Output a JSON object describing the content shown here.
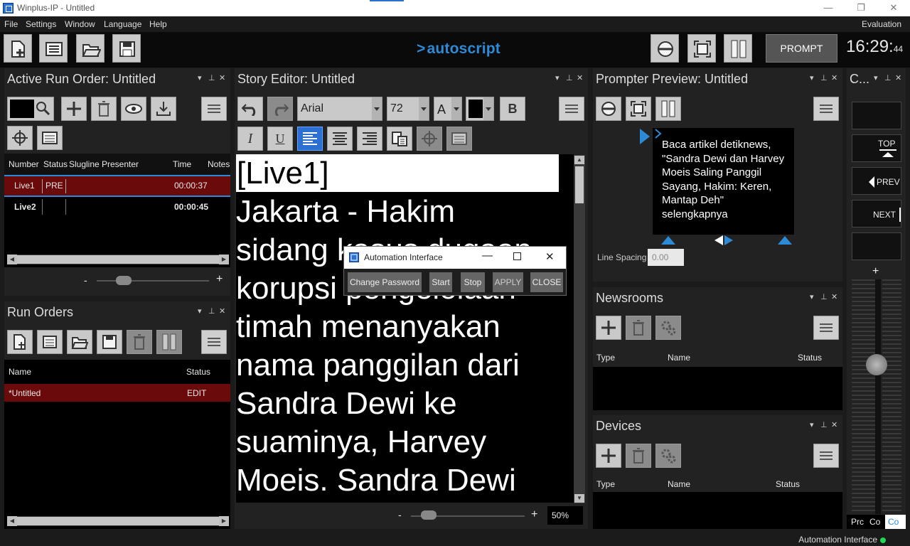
{
  "window": {
    "title": "Winplus-IP - Untitled",
    "controls": {
      "minimize": "—",
      "restore": "❐",
      "close": "✕"
    }
  },
  "menubar": {
    "items": [
      "File",
      "Settings",
      "Window",
      "Language",
      "Help"
    ],
    "license": "Evaluation"
  },
  "toolbar": {
    "brand": "autoscript",
    "prompt_label": "PROMPT",
    "clock_main": "16:29:",
    "clock_seconds": "44"
  },
  "active_run_order": {
    "title": "Active Run Order: Untitled",
    "columns": [
      "Number",
      "Status",
      "Slugline",
      "Presenter",
      "Time",
      "Notes"
    ],
    "rows": [
      {
        "number": "Live1",
        "status": "PRE",
        "time": "00:00:37"
      },
      {
        "number": "Live2",
        "status": "",
        "time": "00:00:45"
      }
    ],
    "zoom_minus": "-",
    "zoom_plus": "+"
  },
  "run_orders": {
    "title": "Run Orders",
    "columns": [
      "Name",
      "Status"
    ],
    "rows": [
      {
        "name": "*Untitled",
        "status": "EDIT"
      }
    ]
  },
  "story_editor": {
    "title": "Story Editor: Untitled",
    "font": "Arial",
    "size": "72",
    "text_color_label": "A",
    "bold": "B",
    "italic": "I",
    "underline": "U",
    "slug": "[Live1]",
    "body": "Jakarta - Hakim\nsidang kasus dugaan\nkorupsi pengelolaan\ntimah menanyakan\nnama panggilan dari\nSandra Dewi ke\nsuaminya, Harvey\nMoeis. Sandra Dewi",
    "zoom_minus": "-",
    "zoom_plus": "+",
    "zoom": "50%"
  },
  "automation_dialog": {
    "title": "Automation Interface",
    "buttons": [
      "Change Password",
      "Start",
      "Stop",
      "APPLY",
      "CLOSE"
    ]
  },
  "prompter_preview": {
    "title": "Prompter Preview: Untitled",
    "text": "Baca artikel detiknews, \"Sandra Dewi dan Harvey Moeis Saling Panggil Sayang, Hakim: Keren, Mantap Deh\" selengkapnya",
    "line_spacing_label": "Line Spacing",
    "line_spacing_value": "0.00"
  },
  "newsrooms": {
    "title": "Newsrooms",
    "columns": [
      "Type",
      "Name",
      "Status"
    ]
  },
  "devices": {
    "title": "Devices",
    "columns": [
      "Type",
      "Name",
      "Status"
    ]
  },
  "control_panel": {
    "title": "C...",
    "buttons": [
      "TOP",
      "PREV",
      "NEXT"
    ],
    "plus": "+",
    "tabs": [
      "Prc",
      "Co",
      "Co"
    ]
  },
  "statusbar": {
    "automation_label": "Automation Interface",
    "status_color": "#1fd655"
  },
  "colors": {
    "accent": "#2d8ad6",
    "selected_row": "#6b0a0a",
    "panel_header": "#222222"
  }
}
